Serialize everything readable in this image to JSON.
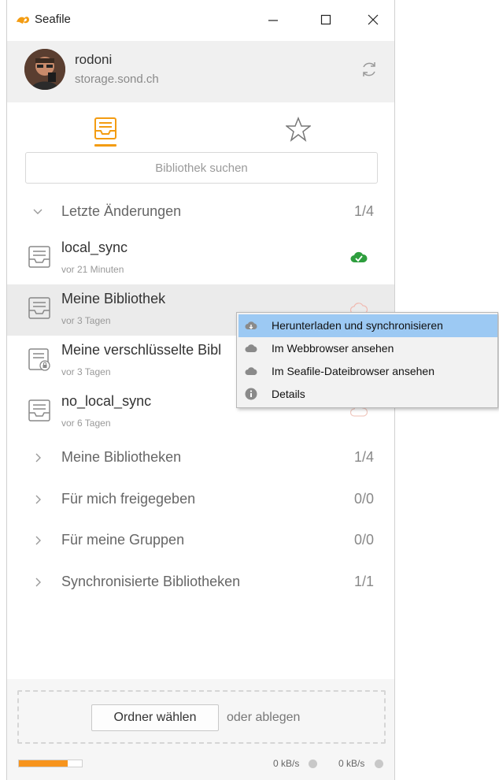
{
  "window": {
    "title": "Seafile"
  },
  "account": {
    "name": "rodoni",
    "server": "storage.sond.ch"
  },
  "search": {
    "placeholder": "Bibliothek suchen"
  },
  "recent": {
    "label": "Letzte Änderungen",
    "count": "1/4"
  },
  "repos": [
    {
      "name": "local_sync",
      "time": "vor 21 Minuten",
      "status": "synced"
    },
    {
      "name": "Meine Bibliothek",
      "time": "vor 3 Tagen",
      "status": "cloud"
    },
    {
      "name": "Meine verschlüsselte Bibl",
      "time": "vor 3 Tagen",
      "status": "cloud"
    },
    {
      "name": "no_local_sync",
      "time": "vor 6 Tagen",
      "status": "cloud"
    }
  ],
  "sections": [
    {
      "label": "Meine Bibliotheken",
      "count": "1/4"
    },
    {
      "label": "Für mich freigegeben",
      "count": "0/0"
    },
    {
      "label": "Für meine Gruppen",
      "count": "0/0"
    },
    {
      "label": "Synchronisierte Bibliotheken",
      "count": "1/1"
    }
  ],
  "footer": {
    "choose_label": "Ordner wählen",
    "drop_label": "oder ablegen",
    "upload_rate": "0 kB/s",
    "download_rate": "0 kB/s",
    "quota_fraction": 0.78
  },
  "context_menu": {
    "items": [
      {
        "label": "Herunterladen und synchronisieren",
        "icon": "cloud-download-icon"
      },
      {
        "label": "Im Webbrowser ansehen",
        "icon": "cloud-icon"
      },
      {
        "label": "Im Seafile-Dateibrowser ansehen",
        "icon": "cloud-icon"
      },
      {
        "label": "Details",
        "icon": "info-icon"
      }
    ]
  },
  "colors": {
    "accent": "#f39c12",
    "synced": "#2e9e3e",
    "menu_hover": "#9cc9f3"
  }
}
